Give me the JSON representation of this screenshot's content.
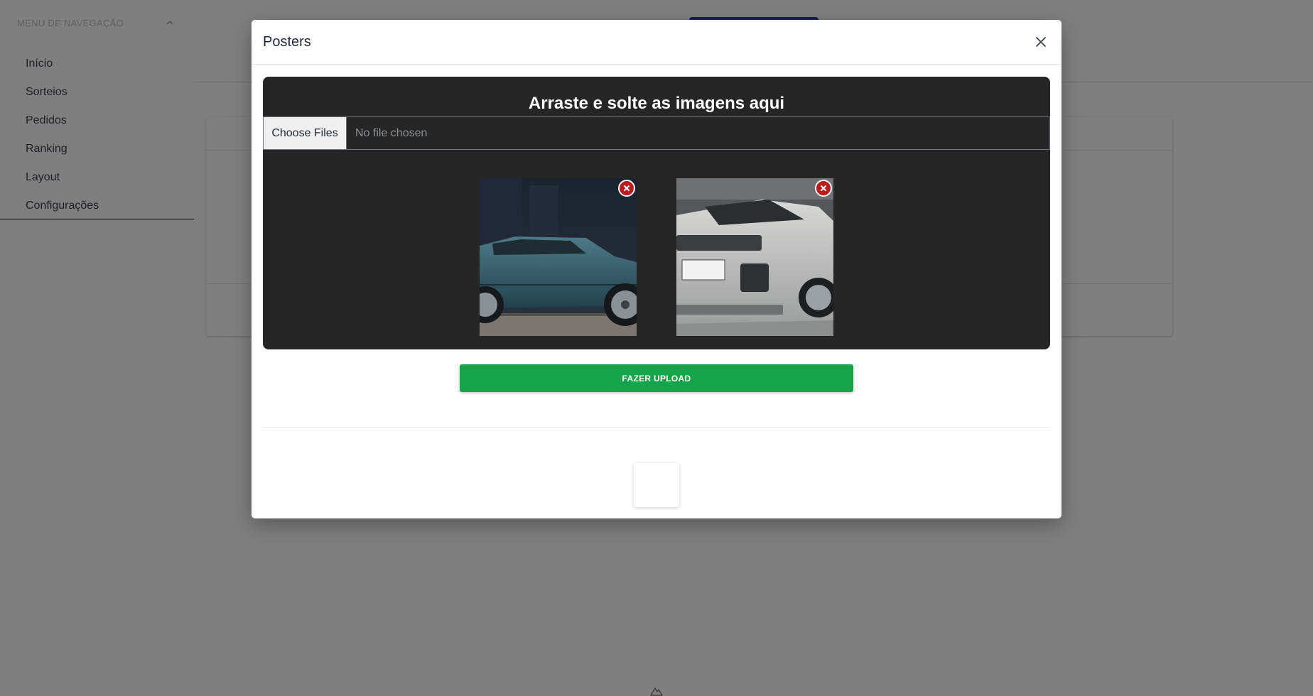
{
  "sidebar": {
    "header_label": "MENU DE NAVEGAÇÃO",
    "items": [
      {
        "label": "Início"
      },
      {
        "label": "Sorteios"
      },
      {
        "label": "Pedidos"
      },
      {
        "label": "Ranking"
      },
      {
        "label": "Layout"
      },
      {
        "label": "Configurações"
      }
    ]
  },
  "modal": {
    "title": "Posters",
    "dropzone_title": "Arraste e solte as imagens aqui",
    "file_input": {
      "button_label": "Choose Files",
      "status": "No file chosen"
    },
    "thumbnails": [
      {
        "subject": "blue suv side view",
        "icon": "remove-x-icon"
      },
      {
        "subject": "silver suv front view",
        "icon": "remove-x-icon"
      }
    ],
    "upload_label": "FAZER UPLOAD"
  },
  "colors": {
    "dropzone_bg": "#262626",
    "upload_button": "#16a34a",
    "remove_badge": "#b91c1c",
    "primary_button": "#1e40af"
  }
}
